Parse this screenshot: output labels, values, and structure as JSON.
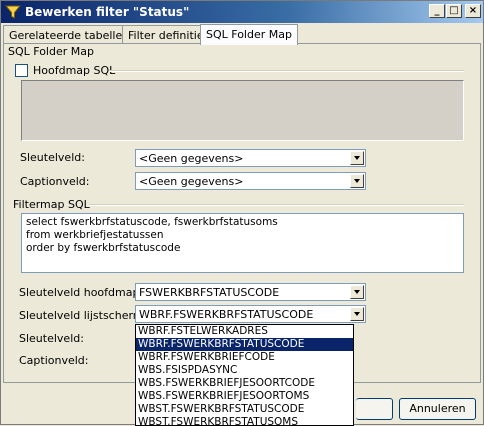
{
  "window": {
    "title": "Bewerken filter \"Status\"",
    "controls": {
      "minimize": "_",
      "maximize": "□",
      "close": "×"
    }
  },
  "tabs": [
    {
      "label": "Gerelateerde tabellen",
      "active": false
    },
    {
      "label": "Filter definitie",
      "active": false
    },
    {
      "label": "SQL Folder Map",
      "active": true
    }
  ],
  "panel": {
    "heading": "SQL Folder Map",
    "hoofdmap_checkbox_label": "Hoofdmap SQL",
    "hoofdmap_checked": false,
    "sleutelveld_label": "Sleutelveld:",
    "sleutelveld_value": "<Geen gegevens>",
    "captionveld_label": "Captionveld:",
    "captionveld_value": "<Geen gegevens>",
    "filtermap_heading": "Filtermap SQL",
    "filtermap_sql": [
      "select fswerkbrfstatuscode, fswerkbrfstatusoms",
      "from werkbriefjestatussen",
      "order by fswerkbrfstatuscode"
    ],
    "sleutelveld_hoofdmap_label": "Sleutelveld hoofdmap:",
    "sleutelveld_hoofdmap_value": "FSWERKBRFSTATUSCODE",
    "sleutelveld_lijstscherm_label": "Sleutelveld lijstscherm:",
    "sleutelveld_lijstscherm_value": "WBRF.FSWERKBRFSTATUSCODE",
    "sleutelveld2_label": "Sleutelveld:",
    "captionveld2_label": "Captionveld:"
  },
  "dropdown_options": [
    {
      "label": "WBRF.FSTELWERKADRES",
      "selected": false
    },
    {
      "label": "WBRF.FSWERKBRFSTATUSCODE",
      "selected": true
    },
    {
      "label": "WBRF.FSWERKBRIEFCODE",
      "selected": false
    },
    {
      "label": "WBS.FSISPDASYNC",
      "selected": false
    },
    {
      "label": "WBS.FSWERKBRIEFJESOORTCODE",
      "selected": false
    },
    {
      "label": "WBS.FSWERKBRIEFJESOORTOMS",
      "selected": false
    },
    {
      "label": "WBST.FSWERKBRFSTATUSCODE",
      "selected": false
    },
    {
      "label": "WBST.FSWERKBRFSTATUSOMS",
      "selected": false
    }
  ],
  "buttons": {
    "cancel": "Annuleren"
  },
  "colors": {
    "title_start": "#0a246a",
    "title_end": "#a6caf0",
    "selection": "#0a246a"
  }
}
